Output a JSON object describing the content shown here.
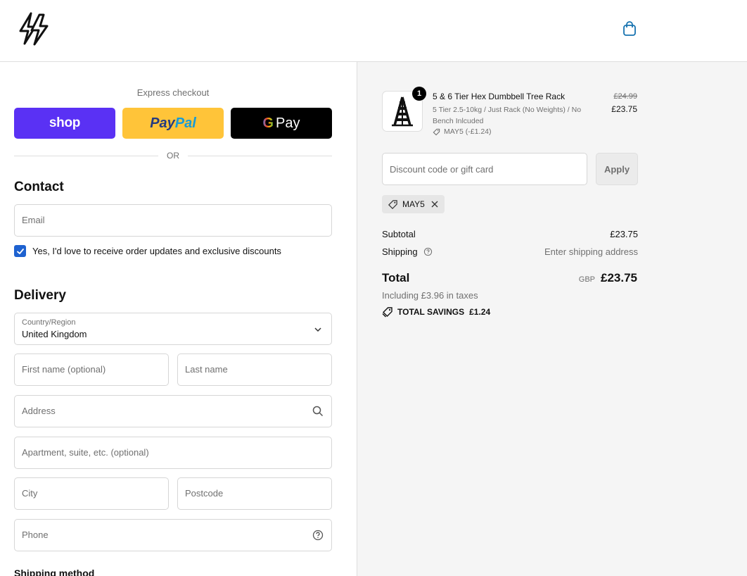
{
  "header": {
    "logo_icon": "lightning-bolt-logo-icon",
    "cart_icon": "shopping-bag-icon"
  },
  "express": {
    "title": "Express checkout",
    "shop_label": "shop",
    "paypal_label_1": "Pay",
    "paypal_label_2": "Pal",
    "gpay_g": "G",
    "gpay_label": "Pay",
    "or_label": "OR"
  },
  "contact": {
    "title": "Contact",
    "email_placeholder": "Email",
    "marketing_label": "Yes, I'd love to receive order updates and exclusive discounts",
    "marketing_checked": true
  },
  "delivery": {
    "title": "Delivery",
    "country_label": "Country/Region",
    "country_value": "United Kingdom",
    "first_name_placeholder": "First name (optional)",
    "last_name_placeholder": "Last name",
    "address_placeholder": "Address",
    "apartment_placeholder": "Apartment, suite, etc. (optional)",
    "city_placeholder": "City",
    "postcode_placeholder": "Postcode",
    "phone_placeholder": "Phone"
  },
  "shipping_method": {
    "title": "Shipping method"
  },
  "order": {
    "quantity": "1",
    "product_name": "5 & 6 Tier Hex Dumbbell Tree Rack",
    "variant": "5 Tier 2.5-10kg / Just Rack (No Weights) / No Bench Inlcuded",
    "line_discount": "MAY5 (-£1.24)",
    "price_original": "£24.99",
    "price_final": "£23.75"
  },
  "discount": {
    "placeholder": "Discount code or gift card",
    "apply_label": "Apply",
    "applied_code": "MAY5"
  },
  "summary": {
    "subtotal_label": "Subtotal",
    "subtotal_value": "£23.75",
    "shipping_label": "Shipping",
    "shipping_value": "Enter shipping address",
    "total_label": "Total",
    "currency": "GBP",
    "total_value": "£23.75",
    "tax_note": "Including £3.96 in taxes",
    "savings_label": "TOTAL SAVINGS",
    "savings_value": "£1.24"
  },
  "colors": {
    "shop": "#5a31f4",
    "paypal": "#ffc439",
    "gpay": "#000000",
    "checkbox": "#1e62d0",
    "sidebar_bg": "#f5f5f5"
  }
}
